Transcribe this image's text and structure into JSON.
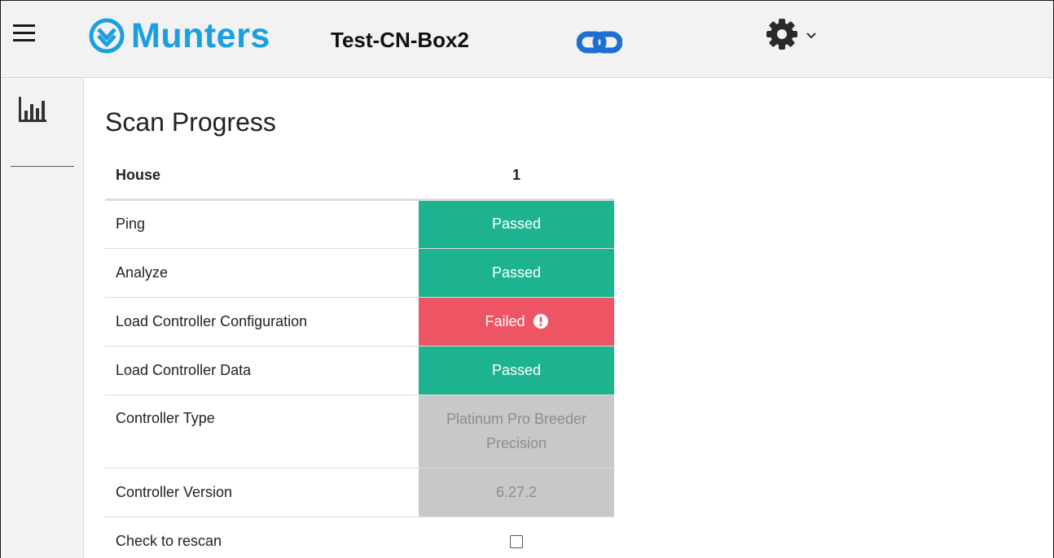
{
  "header": {
    "brand": "Munters",
    "device_name": "Test-CN-Box2"
  },
  "colors": {
    "brand": "#1a9fe0",
    "passed": "#1db390",
    "failed": "#ee5564",
    "info": "#c8c8c8"
  },
  "icons": [
    "hamburger-menu-icon",
    "munters-logo-icon",
    "link-icon",
    "gear-icon",
    "chevron-down-icon",
    "bar-chart-icon",
    "alert-icon"
  ],
  "page": {
    "title": "Scan Progress"
  },
  "table": {
    "header": {
      "label": "House",
      "value": "1"
    },
    "rows": [
      {
        "label": "Ping",
        "value": "Passed",
        "status": "passed"
      },
      {
        "label": "Analyze",
        "value": "Passed",
        "status": "passed"
      },
      {
        "label": "Load Controller Configuration",
        "value": "Failed",
        "status": "failed"
      },
      {
        "label": "Load Controller Data",
        "value": "Passed",
        "status": "passed"
      },
      {
        "label": "Controller Type",
        "value": "Platinum Pro Breeder Precision",
        "status": "info"
      },
      {
        "label": "Controller Version",
        "value": "6.27.2",
        "status": "info"
      },
      {
        "label": "Check to rescan",
        "value": "",
        "status": "checkbox"
      }
    ]
  }
}
